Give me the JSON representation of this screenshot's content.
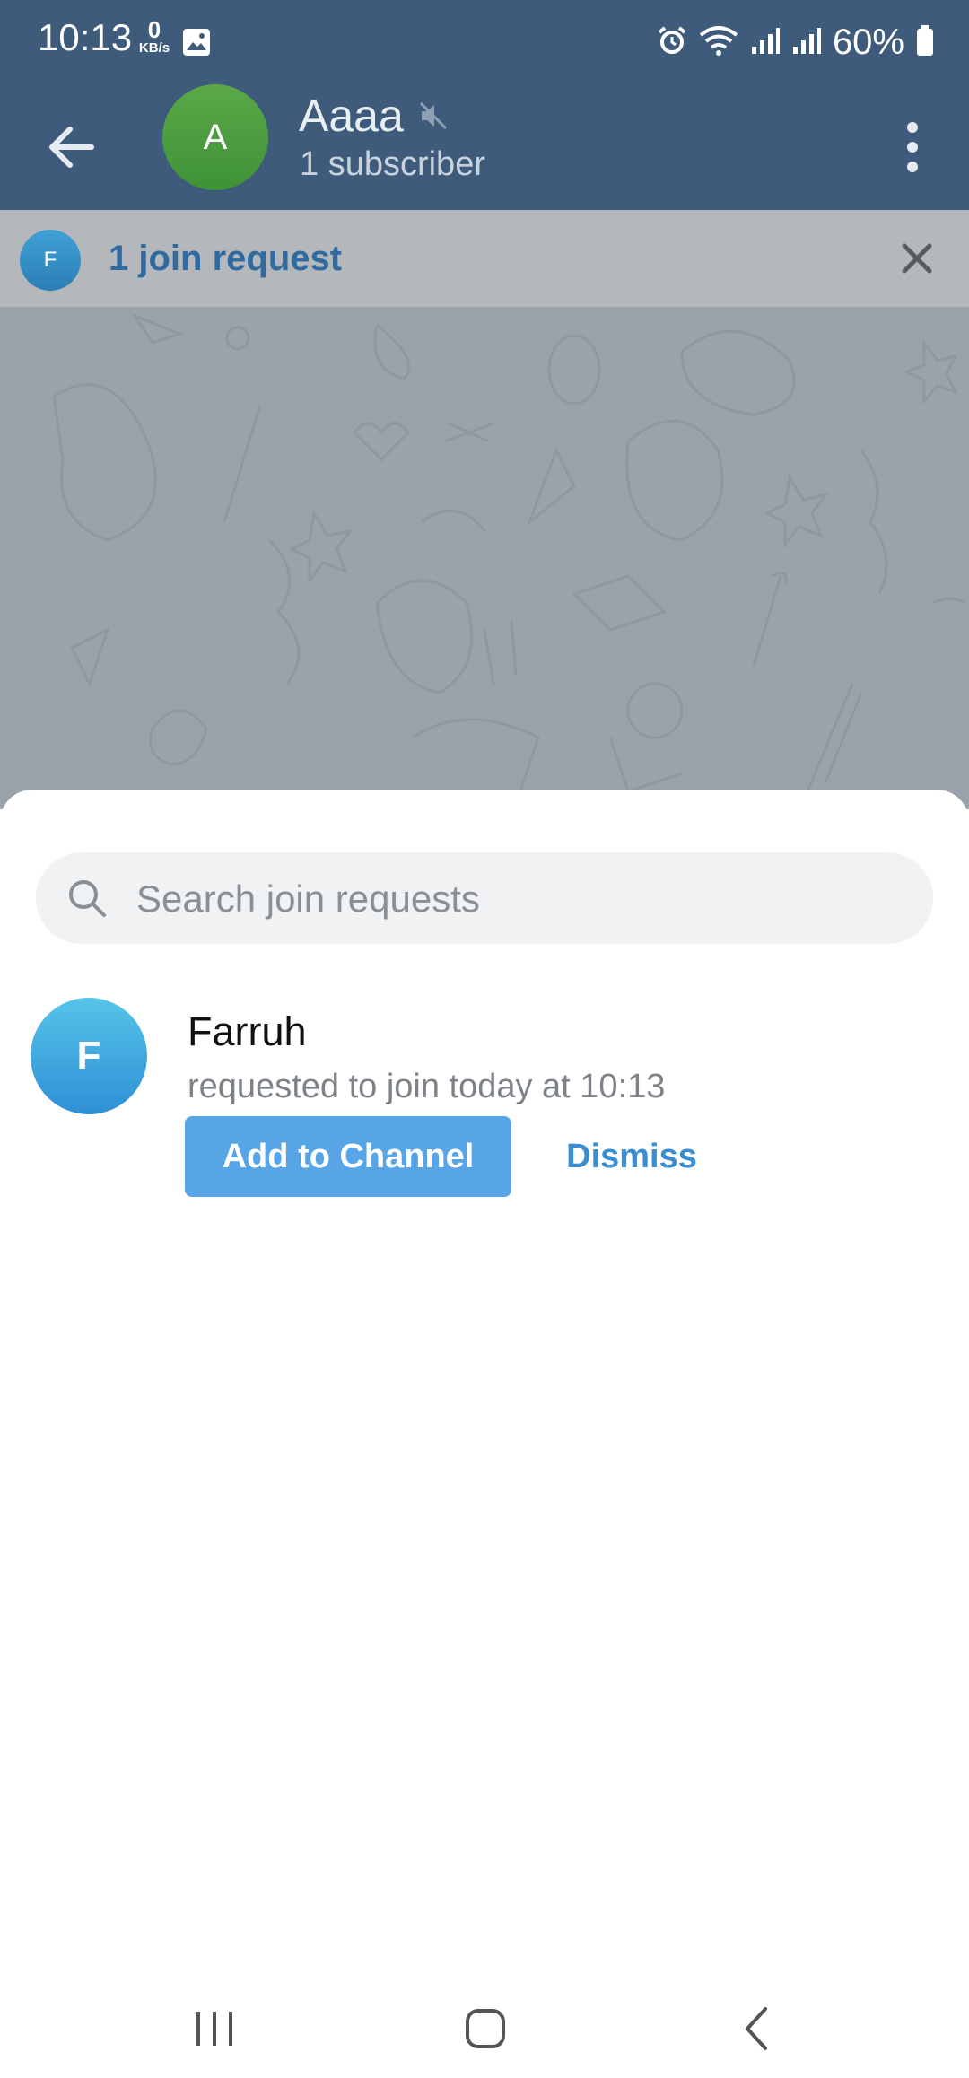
{
  "status_bar": {
    "time": "10:13",
    "net_speed_value": "0",
    "net_speed_unit": "KB/s",
    "battery_percent": "60%",
    "icons": [
      "photo-icon",
      "alarm-icon",
      "wifi-icon",
      "signal-icon",
      "signal-icon",
      "battery-icon"
    ]
  },
  "header": {
    "avatar_letter": "A",
    "channel_name": "Aaaa",
    "subscribers": "1 subscriber",
    "avatar_color": "#4f9f3f",
    "muted": true
  },
  "join_banner": {
    "avatar_letter": "F",
    "text": "1 join request"
  },
  "sheet": {
    "search_placeholder": "Search join requests",
    "requests": [
      {
        "avatar_letter": "F",
        "name": "Farruh",
        "subtitle": "requested to join today at 10:13",
        "add_label": "Add to Channel",
        "dismiss_label": "Dismiss"
      }
    ]
  },
  "colors": {
    "header_bg": "#3e5b7b",
    "accent": "#57a5e6",
    "link": "#3a8dd0"
  }
}
